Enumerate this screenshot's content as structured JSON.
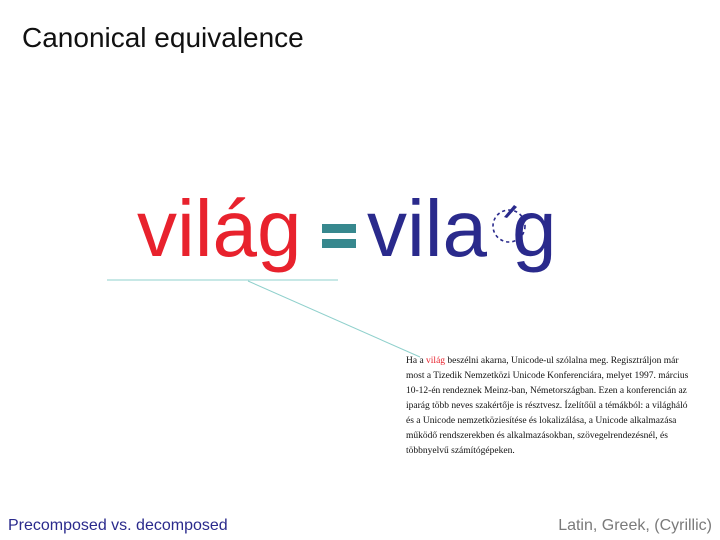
{
  "slide": {
    "title": "Canonical equivalence",
    "precomposed_word": "világ",
    "decomposed_word": {
      "before": "vila",
      "after": "g"
    },
    "sample": {
      "intro": "Ha a ",
      "highlight": "világ",
      "rest": " beszélni akarna, Unicode-ul szólalna meg. Regisztráljon már most a Tizedik Nemzetközi Unicode Konferenciára, melyet 1997. március 10-12-én rendeznek Meinz-ban, Németországban. Ezen a konferencián az iparág több neves szakértője is résztvesz. Ízelítőül a témákból: a világháló és a Unicode nemzetköziesítése és lokalizálása, a Unicode alkalmazása működő rendszerekben és alkalmazásokban, szövegelrendezésnél, és többnyelvű számítógépeken."
    },
    "footer_left": "Precomposed vs. decomposed",
    "footer_right": "Latin, Greek, (Cyrillic)"
  },
  "colors": {
    "precomposed": "#e8222d",
    "decomposed": "#2a2a8c",
    "equals": "#37888e",
    "connector": "#8fd0cc"
  }
}
